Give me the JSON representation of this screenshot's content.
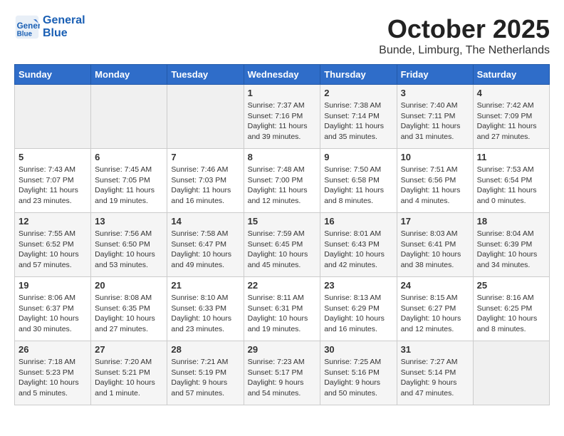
{
  "header": {
    "logo_line1": "General",
    "logo_line2": "Blue",
    "month": "October 2025",
    "location": "Bunde, Limburg, The Netherlands"
  },
  "days_of_week": [
    "Sunday",
    "Monday",
    "Tuesday",
    "Wednesday",
    "Thursday",
    "Friday",
    "Saturday"
  ],
  "weeks": [
    [
      {
        "day": "",
        "info": ""
      },
      {
        "day": "",
        "info": ""
      },
      {
        "day": "",
        "info": ""
      },
      {
        "day": "1",
        "info": "Sunrise: 7:37 AM\nSunset: 7:16 PM\nDaylight: 11 hours\nand 39 minutes."
      },
      {
        "day": "2",
        "info": "Sunrise: 7:38 AM\nSunset: 7:14 PM\nDaylight: 11 hours\nand 35 minutes."
      },
      {
        "day": "3",
        "info": "Sunrise: 7:40 AM\nSunset: 7:11 PM\nDaylight: 11 hours\nand 31 minutes."
      },
      {
        "day": "4",
        "info": "Sunrise: 7:42 AM\nSunset: 7:09 PM\nDaylight: 11 hours\nand 27 minutes."
      }
    ],
    [
      {
        "day": "5",
        "info": "Sunrise: 7:43 AM\nSunset: 7:07 PM\nDaylight: 11 hours\nand 23 minutes."
      },
      {
        "day": "6",
        "info": "Sunrise: 7:45 AM\nSunset: 7:05 PM\nDaylight: 11 hours\nand 19 minutes."
      },
      {
        "day": "7",
        "info": "Sunrise: 7:46 AM\nSunset: 7:03 PM\nDaylight: 11 hours\nand 16 minutes."
      },
      {
        "day": "8",
        "info": "Sunrise: 7:48 AM\nSunset: 7:00 PM\nDaylight: 11 hours\nand 12 minutes."
      },
      {
        "day": "9",
        "info": "Sunrise: 7:50 AM\nSunset: 6:58 PM\nDaylight: 11 hours\nand 8 minutes."
      },
      {
        "day": "10",
        "info": "Sunrise: 7:51 AM\nSunset: 6:56 PM\nDaylight: 11 hours\nand 4 minutes."
      },
      {
        "day": "11",
        "info": "Sunrise: 7:53 AM\nSunset: 6:54 PM\nDaylight: 11 hours\nand 0 minutes."
      }
    ],
    [
      {
        "day": "12",
        "info": "Sunrise: 7:55 AM\nSunset: 6:52 PM\nDaylight: 10 hours\nand 57 minutes."
      },
      {
        "day": "13",
        "info": "Sunrise: 7:56 AM\nSunset: 6:50 PM\nDaylight: 10 hours\nand 53 minutes."
      },
      {
        "day": "14",
        "info": "Sunrise: 7:58 AM\nSunset: 6:47 PM\nDaylight: 10 hours\nand 49 minutes."
      },
      {
        "day": "15",
        "info": "Sunrise: 7:59 AM\nSunset: 6:45 PM\nDaylight: 10 hours\nand 45 minutes."
      },
      {
        "day": "16",
        "info": "Sunrise: 8:01 AM\nSunset: 6:43 PM\nDaylight: 10 hours\nand 42 minutes."
      },
      {
        "day": "17",
        "info": "Sunrise: 8:03 AM\nSunset: 6:41 PM\nDaylight: 10 hours\nand 38 minutes."
      },
      {
        "day": "18",
        "info": "Sunrise: 8:04 AM\nSunset: 6:39 PM\nDaylight: 10 hours\nand 34 minutes."
      }
    ],
    [
      {
        "day": "19",
        "info": "Sunrise: 8:06 AM\nSunset: 6:37 PM\nDaylight: 10 hours\nand 30 minutes."
      },
      {
        "day": "20",
        "info": "Sunrise: 8:08 AM\nSunset: 6:35 PM\nDaylight: 10 hours\nand 27 minutes."
      },
      {
        "day": "21",
        "info": "Sunrise: 8:10 AM\nSunset: 6:33 PM\nDaylight: 10 hours\nand 23 minutes."
      },
      {
        "day": "22",
        "info": "Sunrise: 8:11 AM\nSunset: 6:31 PM\nDaylight: 10 hours\nand 19 minutes."
      },
      {
        "day": "23",
        "info": "Sunrise: 8:13 AM\nSunset: 6:29 PM\nDaylight: 10 hours\nand 16 minutes."
      },
      {
        "day": "24",
        "info": "Sunrise: 8:15 AM\nSunset: 6:27 PM\nDaylight: 10 hours\nand 12 minutes."
      },
      {
        "day": "25",
        "info": "Sunrise: 8:16 AM\nSunset: 6:25 PM\nDaylight: 10 hours\nand 8 minutes."
      }
    ],
    [
      {
        "day": "26",
        "info": "Sunrise: 7:18 AM\nSunset: 5:23 PM\nDaylight: 10 hours\nand 5 minutes."
      },
      {
        "day": "27",
        "info": "Sunrise: 7:20 AM\nSunset: 5:21 PM\nDaylight: 10 hours\nand 1 minute."
      },
      {
        "day": "28",
        "info": "Sunrise: 7:21 AM\nSunset: 5:19 PM\nDaylight: 9 hours\nand 57 minutes."
      },
      {
        "day": "29",
        "info": "Sunrise: 7:23 AM\nSunset: 5:17 PM\nDaylight: 9 hours\nand 54 minutes."
      },
      {
        "day": "30",
        "info": "Sunrise: 7:25 AM\nSunset: 5:16 PM\nDaylight: 9 hours\nand 50 minutes."
      },
      {
        "day": "31",
        "info": "Sunrise: 7:27 AM\nSunset: 5:14 PM\nDaylight: 9 hours\nand 47 minutes."
      },
      {
        "day": "",
        "info": ""
      }
    ]
  ]
}
